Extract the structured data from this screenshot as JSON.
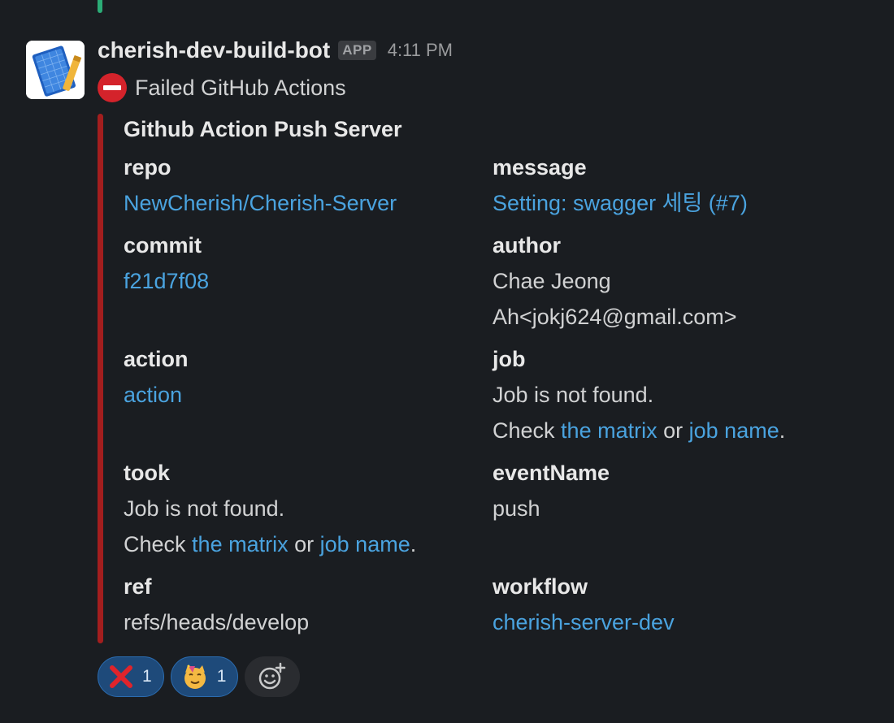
{
  "message": {
    "bot_name": "cherish-dev-build-bot",
    "badge": "APP",
    "timestamp": "4:11 PM",
    "text": "Failed GitHub Actions",
    "status_icon": "no-entry-icon"
  },
  "attachment": {
    "title": "Github Action Push Server",
    "accent_color": "#a31e1e",
    "fields": {
      "repo": {
        "label": "repo",
        "value": "NewCherish/Cherish-Server"
      },
      "message": {
        "label": "message",
        "value": "Setting: swagger 세팅 (#7)"
      },
      "commit": {
        "label": "commit",
        "value": "f21d7f08"
      },
      "author": {
        "label": "author",
        "line1": "Chae Jeong",
        "line2": "Ah<jokj624@gmail.com>"
      },
      "action": {
        "label": "action",
        "value": "action"
      },
      "job": {
        "label": "job",
        "line1": "Job is not found.",
        "check": "Check",
        "matrix_link": "the matrix",
        "or": "or",
        "jobname_link": "job name",
        "period": "."
      },
      "took": {
        "label": "took",
        "line1": "Job is not found.",
        "check": "Check",
        "matrix_link": "the matrix",
        "or": "or",
        "jobname_link": "job name",
        "period": "."
      },
      "eventName": {
        "label": "eventName",
        "value": "push"
      },
      "ref": {
        "label": "ref",
        "value": "refs/heads/develop"
      },
      "workflow": {
        "label": "workflow",
        "value": "cherish-server-dev"
      }
    }
  },
  "reactions": [
    {
      "emoji": "cross-mark-icon",
      "count": "1"
    },
    {
      "emoji": "partying-cat-icon",
      "count": "1"
    }
  ],
  "colors": {
    "link": "#4aa3df",
    "background": "#1a1d21",
    "reaction_bg": "#1e4a7a"
  }
}
